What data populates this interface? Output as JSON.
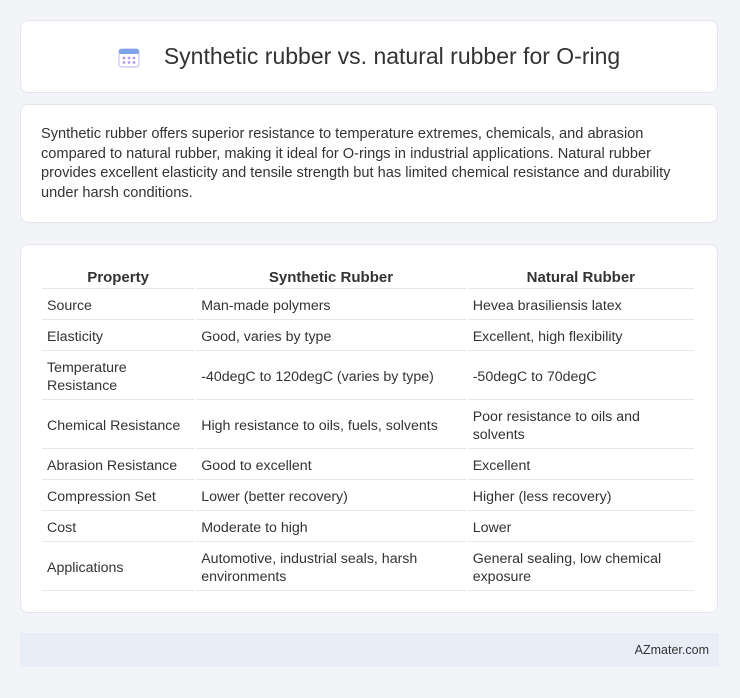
{
  "header": {
    "title": "Synthetic rubber vs. natural rubber for O-ring",
    "icon": "calendar-icon"
  },
  "summary": {
    "text": "Synthetic rubber offers superior resistance to temperature extremes, chemicals, and abrasion compared to natural rubber, making it ideal for O-rings in industrial applications. Natural rubber provides excellent elasticity and tensile strength but has limited chemical resistance and durability under harsh conditions."
  },
  "table": {
    "headers": [
      "Property",
      "Synthetic Rubber",
      "Natural Rubber"
    ],
    "rows": [
      [
        "Source",
        "Man-made polymers",
        "Hevea brasiliensis latex"
      ],
      [
        "Elasticity",
        "Good, varies by type",
        "Excellent, high flexibility"
      ],
      [
        "Temperature Resistance",
        "-40degC to 120degC (varies by type)",
        "-50degC to 70degC"
      ],
      [
        "Chemical Resistance",
        "High resistance to oils, fuels, solvents",
        "Poor resistance to oils and solvents"
      ],
      [
        "Abrasion Resistance",
        "Good to excellent",
        "Excellent"
      ],
      [
        "Compression Set",
        "Lower (better recovery)",
        "Higher (less recovery)"
      ],
      [
        "Cost",
        "Moderate to high",
        "Lower"
      ],
      [
        "Applications",
        "Automotive, industrial seals, harsh environments",
        "General sealing, low chemical exposure"
      ]
    ]
  },
  "footer": {
    "text": "AZmater.com"
  },
  "colors": {
    "page_bg": "#f3f4f8",
    "card_bg": "#ffffff",
    "footer_bg": "#e9edf7",
    "icon_accent": "#9b8fe6"
  }
}
